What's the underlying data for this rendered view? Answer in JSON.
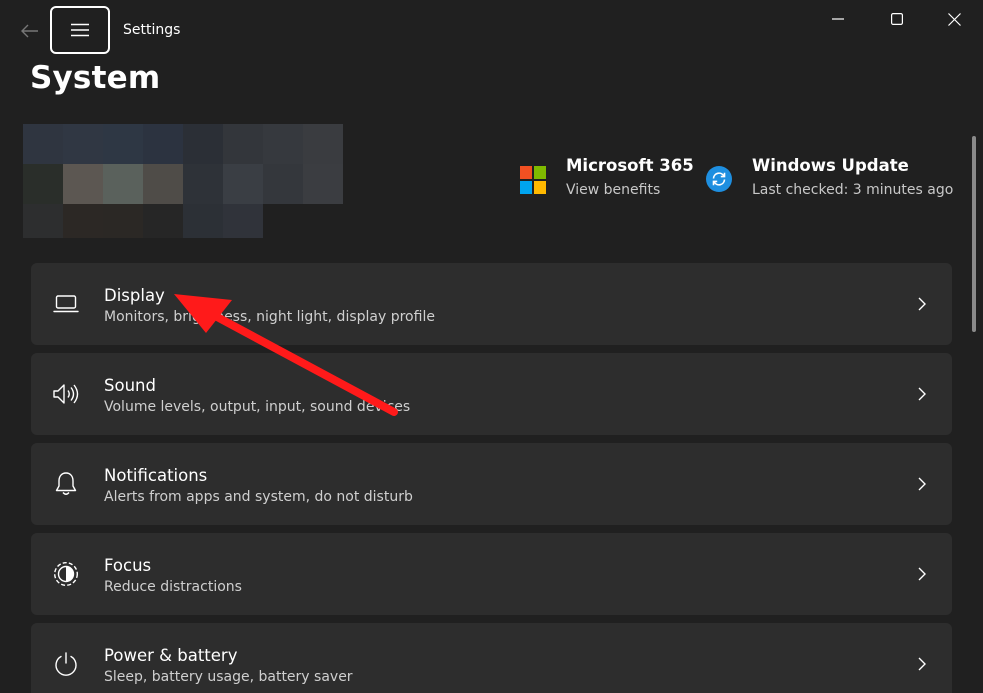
{
  "window": {
    "app_title": "Settings",
    "back_icon": "back-arrow-icon",
    "menu_icon": "hamburger-menu-icon",
    "controls": [
      "minimize-icon",
      "maximize-icon",
      "close-icon"
    ]
  },
  "page": {
    "title": "System"
  },
  "promos": [
    {
      "title": "Microsoft 365",
      "subtitle": "View benefits",
      "icon": "microsoft-logo-icon"
    },
    {
      "title": "Windows Update",
      "subtitle": "Last checked: 3 minutes ago",
      "icon": "windows-update-icon"
    }
  ],
  "settings": [
    {
      "title": "Display",
      "subtitle": "Monitors, brightness, night light, display profile",
      "icon": "laptop-icon"
    },
    {
      "title": "Sound",
      "subtitle": "Volume levels, output, input, sound devices",
      "icon": "speaker-icon"
    },
    {
      "title": "Notifications",
      "subtitle": "Alerts from apps and system, do not disturb",
      "icon": "bell-icon"
    },
    {
      "title": "Focus",
      "subtitle": "Reduce distractions",
      "icon": "focus-icon"
    },
    {
      "title": "Power & battery",
      "subtitle": "Sleep, battery usage, battery saver",
      "icon": "power-icon"
    }
  ],
  "colors": {
    "background": "#202020",
    "card": "#2d2d2d",
    "annotation_arrow": "#ff1a1a",
    "update_blue": "#1e8fe0"
  }
}
